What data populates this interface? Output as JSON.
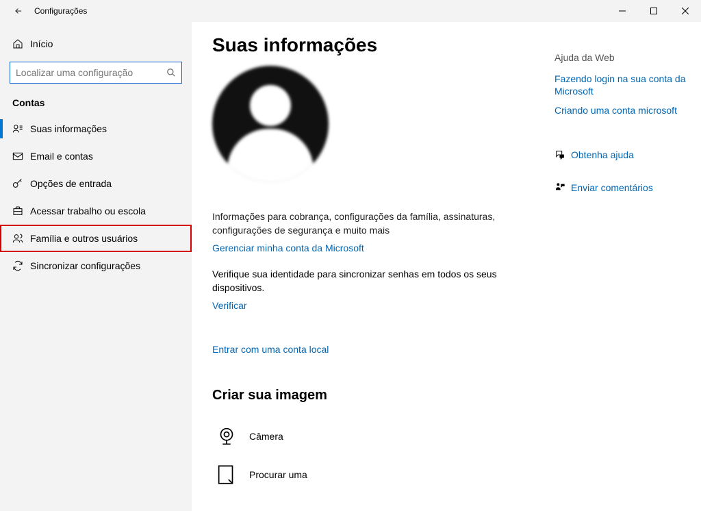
{
  "window": {
    "title": "Configurações"
  },
  "sidebar": {
    "home": "Início",
    "search_placeholder": "Localizar uma configuração",
    "group": "Contas",
    "items": [
      {
        "label": "Suas informações"
      },
      {
        "label": "Email e contas"
      },
      {
        "label": "Opções de entrada"
      },
      {
        "label": "Acessar trabalho ou escola"
      },
      {
        "label": "Família e outros usuários"
      },
      {
        "label": "Sincronizar configurações"
      }
    ]
  },
  "main": {
    "title": "Suas informações",
    "info_para": "Informações para cobrança, configurações da família, assinaturas, configurações de segurança e muito mais",
    "manage_link": "Gerenciar minha conta da Microsoft",
    "verify_para": "Verifique sua identidade para sincronizar senhas em todos os seus dispositivos.",
    "verify_link": "Verificar",
    "local_link": "Entrar com uma conta local",
    "create_image_title": "Criar sua imagem",
    "camera_label": "Câmera",
    "browse_label": "Procurar uma"
  },
  "help": {
    "heading": "Ajuda da Web",
    "links": [
      "Fazendo login na sua conta da Microsoft",
      "Criando uma conta microsoft"
    ],
    "get_help": "Obtenha ajuda",
    "feedback": "Enviar comentários"
  }
}
